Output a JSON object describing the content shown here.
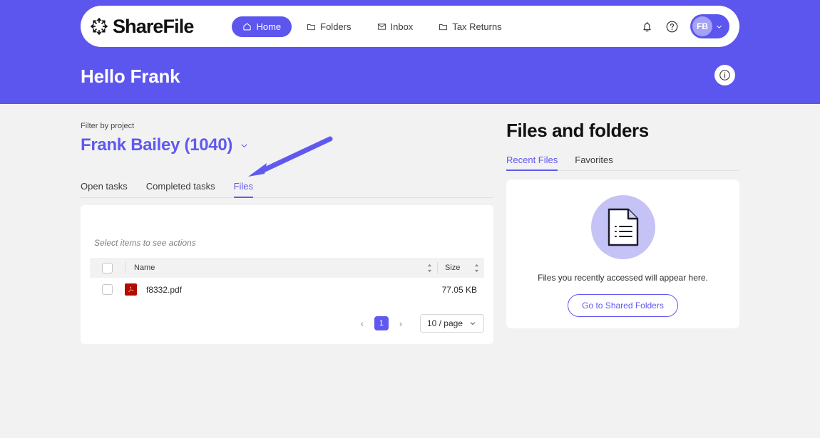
{
  "nav": {
    "logo_text": "ShareFile",
    "logo_icon": "sharefile-burst-icon",
    "items": [
      {
        "label": "Home",
        "icon": "home-icon",
        "active": true
      },
      {
        "label": "Folders",
        "icon": "folder-icon",
        "active": false
      },
      {
        "label": "Inbox",
        "icon": "envelope-icon",
        "active": false
      },
      {
        "label": "Tax Returns",
        "icon": "folder-icon",
        "active": false
      }
    ],
    "bell_icon": "bell-icon",
    "help_icon": "question-circle-icon",
    "avatar_initials": "FB",
    "avatar_chevron": "chevron-down-icon"
  },
  "banner": {
    "greeting": "Hello Frank",
    "info_icon": "info-circle-icon",
    "color": "#5c56ef"
  },
  "left": {
    "filter_label": "Filter by project",
    "project_value": "Frank Bailey (1040)",
    "project_chevron": "chevron-down-icon",
    "tabs": [
      {
        "label": "Open tasks",
        "active": false
      },
      {
        "label": "Completed tasks",
        "active": false
      },
      {
        "label": "Files",
        "active": true
      }
    ],
    "select_hint": "Select items to see actions",
    "table": {
      "columns": [
        "Name",
        "Size"
      ],
      "rows": [
        {
          "name": "f8332.pdf",
          "size": "77.05 KB",
          "icon": "pdf-file-icon"
        }
      ]
    },
    "pagination": {
      "prev": "‹",
      "next": "›",
      "current_page": "1",
      "per_page": "10 / page",
      "per_page_chevron": "chevron-down-icon"
    }
  },
  "right": {
    "title": "Files and folders",
    "tabs": [
      {
        "label": "Recent Files",
        "active": true
      },
      {
        "label": "Favorites",
        "active": false
      }
    ],
    "empty": {
      "illustration": "document-page-icon",
      "message": "Files you recently accessed will appear here.",
      "button_label": "Go to Shared Folders"
    }
  },
  "annotation": {
    "arrow_color": "#6059f0",
    "points_at": "files-tab"
  }
}
